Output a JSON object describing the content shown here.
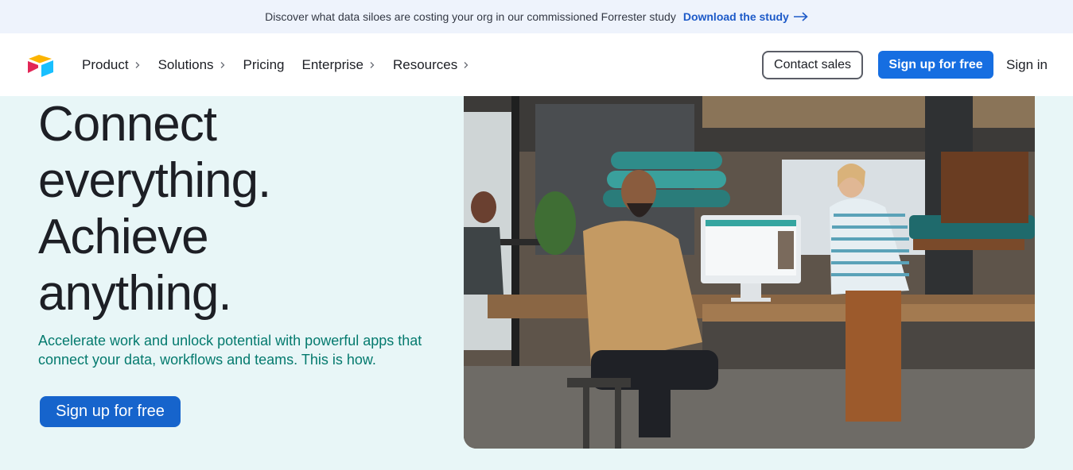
{
  "banner": {
    "message": "Discover what data siloes are costing your org in our commissioned Forrester study",
    "link_label": "Download the study",
    "link_icon": "arrow-right-icon"
  },
  "nav": {
    "logo_icon": "airtable-logo-icon",
    "menu": [
      {
        "label": "Product",
        "has_chevron": true
      },
      {
        "label": "Solutions",
        "has_chevron": true
      },
      {
        "label": "Pricing",
        "has_chevron": false
      },
      {
        "label": "Enterprise",
        "has_chevron": true
      },
      {
        "label": "Resources",
        "has_chevron": true
      }
    ],
    "contact_sales": "Contact sales",
    "sign_up": "Sign up for free",
    "sign_in": "Sign in"
  },
  "hero": {
    "headline": [
      "Connect",
      "everything.",
      "Achieve",
      "anything."
    ],
    "subhead": "Accelerate work and unlock potential with powerful apps that connect your data, workflows and teams. This is how.",
    "cta": "Sign up for free"
  },
  "colors": {
    "banner_bg": "#eef3fc",
    "hero_bg": "#e8f6f7",
    "link_blue": "#1d5ac8",
    "primary_blue": "#166ee1",
    "subhead_teal": "#047a6e",
    "text_dark": "#1d1f25"
  }
}
